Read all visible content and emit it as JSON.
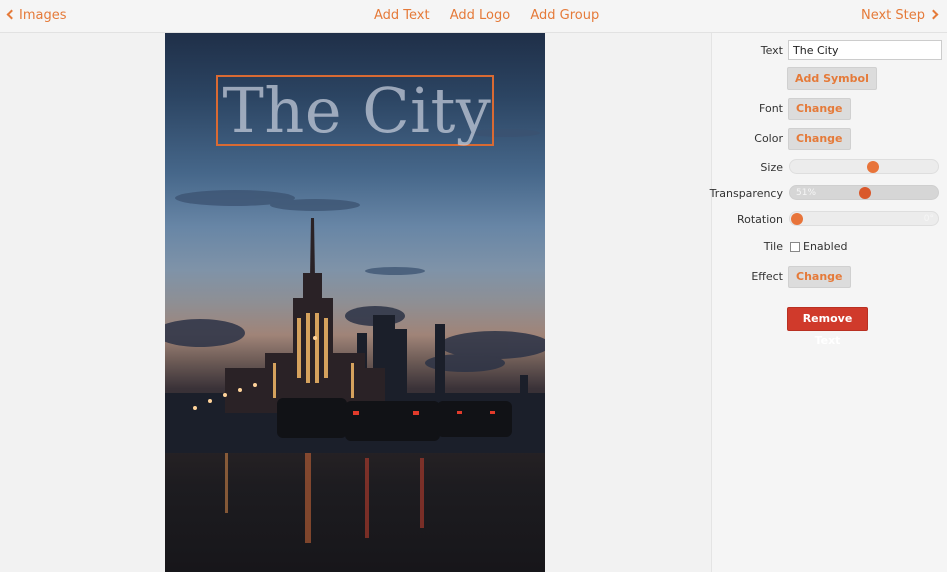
{
  "topbar": {
    "back_label": "Images",
    "add_text_label": "Add Text",
    "add_logo_label": "Add Logo",
    "add_group_label": "Add Group",
    "next_label": "Next Step"
  },
  "watermark": {
    "text": "The City"
  },
  "panel": {
    "text_label": "Text",
    "text_value": "The City",
    "add_symbol_label": "Add Symbol",
    "font_label": "Font",
    "font_button": "Change",
    "color_label": "Color",
    "color_button": "Change",
    "size_label": "Size",
    "size_value": 0.57,
    "transparency_label": "Transparency",
    "transparency_value_text": "51%",
    "transparency_value": 0.51,
    "rotation_label": "Rotation",
    "rotation_value_text": "0°",
    "rotation_value": 0,
    "tile_label": "Tile",
    "tile_checkbox_label": "Enabled",
    "tile_checked": false,
    "effect_label": "Effect",
    "effect_button": "Change",
    "remove_label": "Remove Text"
  },
  "colors": {
    "accent": "#e57a39",
    "remove": "#d03a2b",
    "selection_border": "#d96a33"
  }
}
